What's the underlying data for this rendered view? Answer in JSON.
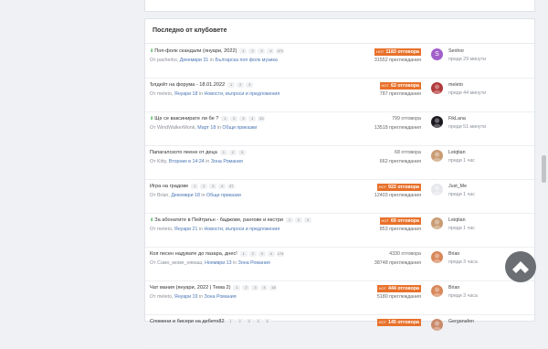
{
  "section": {
    "title": "Последно от клубовете"
  },
  "rows": [
    {
      "title": "Поп-фолк скандали (януари, 2022)",
      "pinned": true,
      "pages": [
        "1",
        "2",
        "3",
        "4",
        "471"
      ],
      "meta": {
        "from": "От pacherko,",
        "date": "Декември 31",
        "in": "in",
        "forum": "Българска поп фолк музика"
      },
      "hot": true,
      "replies": "1183 отговора",
      "views": "31552 преглеждания",
      "user": {
        "name": "Senhor",
        "time": "преди 29 минути",
        "avatar_letter": "S",
        "avatar_color": "#a25fc9"
      }
    },
    {
      "title": "Ъпдейт на форума - 18.01.2022",
      "pinned": false,
      "pages": [
        "1",
        "2",
        "3"
      ],
      "meta": {
        "from": "От meleto,",
        "date": "Януари 18",
        "in": "in",
        "forum": "Новости, въпроси и предложения"
      },
      "hot": true,
      "replies": "63 отговора",
      "views": "787 преглеждания",
      "user": {
        "name": "meleto",
        "time": "преди 44 минути",
        "avatar_letter": "",
        "avatar_color": "#b23a3a"
      }
    },
    {
      "title": "Ще се ваксинирате ли бе ?",
      "pinned": true,
      "pages": [
        "1",
        "2",
        "3",
        "4",
        "33"
      ],
      "meta": {
        "from": "От WindWalkerMonk,",
        "date": "Март 18",
        "in": "in",
        "forum": "Общи приказки"
      },
      "hot": false,
      "replies": "799 отговора",
      "views": "13518 преглеждания",
      "user": {
        "name": "FikLana",
        "time": "преди 51 минути",
        "avatar_letter": "",
        "avatar_color": "#1d1a22"
      }
    },
    {
      "title": "Папагалското пеене от деца",
      "pinned": false,
      "pages": [
        "1",
        "2",
        "3"
      ],
      "meta": {
        "from": "От Kitty,",
        "date": "Вторник в 14:24",
        "in": "in",
        "forum": "Зона Романия"
      },
      "hot": false,
      "replies": "68 отговора",
      "views": "662 преглеждания",
      "user": {
        "name": "Leiqtian",
        "time": "преди 1 час",
        "avatar_letter": "",
        "avatar_color": "#c99c73"
      }
    },
    {
      "title": "Игра на градове",
      "pinned": false,
      "pages": [
        "1",
        "2",
        "3",
        "4",
        "37"
      ],
      "meta": {
        "from": "От Brian,",
        "date": "Декември 18",
        "in": "in",
        "forum": "Общи приказки"
      },
      "hot": true,
      "replies": "922 отговора",
      "views": "12403 преглеждания",
      "user": {
        "name": "Just_Me",
        "time": "преди 1 час",
        "avatar_letter": "",
        "avatar_color": "#e6e8eb"
      }
    },
    {
      "title": "За абонатите в Пейтриън - баджове, рангове и екстри",
      "pinned": true,
      "pages": [
        "1",
        "2",
        "3"
      ],
      "meta": {
        "from": "От meleto,",
        "date": "Януари 21",
        "in": "in",
        "forum": "Новости, въпроси и предложения"
      },
      "hot": true,
      "replies": "69 отговора",
      "views": "853 преглеждания",
      "user": {
        "name": "Leiqtian",
        "time": "преди 1 час",
        "avatar_letter": "",
        "avatar_color": "#c99c73"
      }
    },
    {
      "title": "Коя песен надувате до пазара, днес!",
      "pinned": false,
      "pages": [
        "1",
        "2",
        "3",
        "4",
        "174"
      ],
      "meta": {
        "from": "От Само_моме_нямаш,",
        "date": "Ноември 13",
        "in": "in",
        "forum": "Зона Романия"
      },
      "hot": false,
      "replies": "4330 отговора",
      "views": "38748 преглеждания",
      "user": {
        "name": "Brian",
        "time": "преди 3 часа",
        "avatar_letter": "",
        "avatar_color": "#d9875a"
      }
    },
    {
      "title": "Чат мания (януари, 2022 | Тема 2)",
      "pinned": false,
      "pages": [
        "1",
        "2",
        "3",
        "4",
        "18"
      ],
      "meta": {
        "from": "От meleto,",
        "date": "Януари 19",
        "in": "in",
        "forum": "Зона Романия"
      },
      "hot": true,
      "replies": "444 отговора",
      "views": "5180 преглеждания",
      "user": {
        "name": "Brian",
        "time": "преди 3 часа",
        "avatar_letter": "",
        "avatar_color": "#d9875a"
      }
    },
    {
      "title": "Спомени и бисери на дебето82",
      "pinned": false,
      "pages": [
        "1",
        "2",
        "3",
        "4",
        "6"
      ],
      "meta": {
        "from": "",
        "date": "",
        "in": "",
        "forum": ""
      },
      "hot": true,
      "replies": "145 отговора",
      "views": "",
      "user": {
        "name": "Gerganafen",
        "time": "",
        "avatar_letter": "",
        "avatar_color": "#c98a6a"
      }
    }
  ],
  "hot_tag": "HOT",
  "colors": {
    "hot": "#e8712b",
    "link": "#4a76b5",
    "pin": "#39a84a"
  },
  "icons": {
    "pin": "pin-icon",
    "scroll_top": "chevron-up-icon"
  }
}
